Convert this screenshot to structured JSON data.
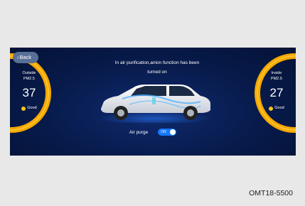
{
  "back_label": "Back",
  "message_line1": "In air purification,anion function has been",
  "message_line2": "turned on",
  "outside": {
    "label1": "Outside",
    "label2": "PM2.5",
    "value": "37",
    "status": "Good"
  },
  "inside": {
    "label1": "Inside",
    "label2": "PM2.5",
    "value": "27",
    "status": "Good"
  },
  "air_purge": {
    "label": "Air purge",
    "state": "ON"
  },
  "reference": "OMT18-5500",
  "colors": {
    "gauge": "#f5a800",
    "toggle": "#1677ff",
    "background": "#071a4a"
  }
}
